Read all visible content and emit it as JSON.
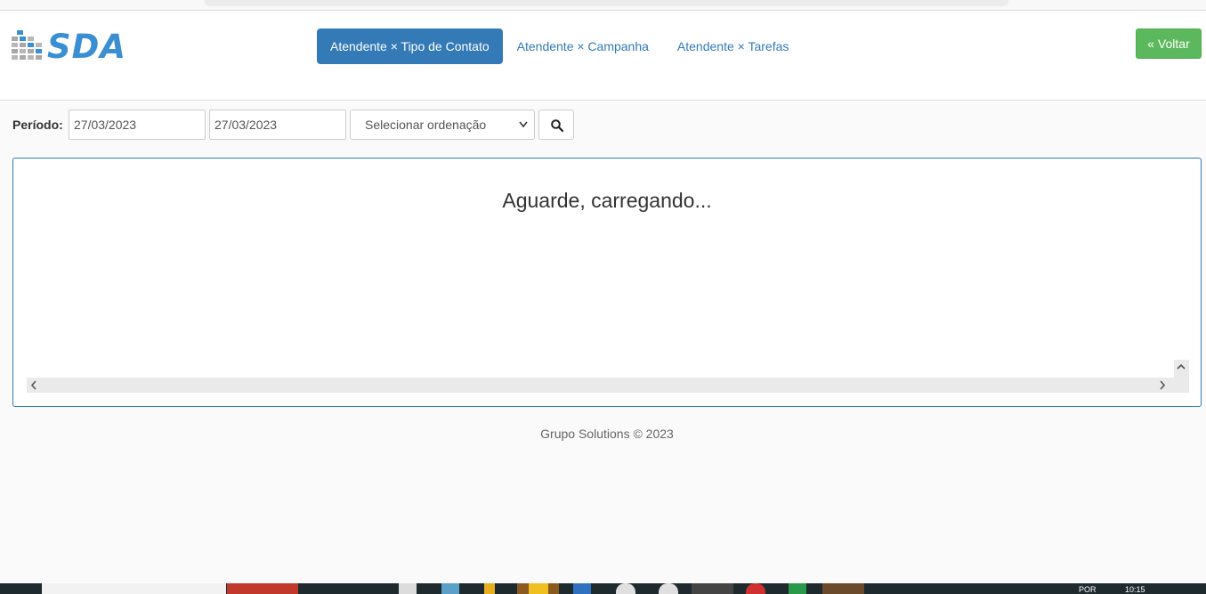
{
  "brand": {
    "logo_text": "SDA",
    "accent_color": "#337ab7"
  },
  "nav": {
    "tabs": [
      {
        "label": "Atendente × Tipo de Contato",
        "active": true
      },
      {
        "label": "Atendente × Campanha",
        "active": false
      },
      {
        "label": "Atendente × Tarefas",
        "active": false
      }
    ],
    "back_label": "« Voltar",
    "back_color": "#5cb85c"
  },
  "filter": {
    "period_label": "Período:",
    "date_start": "27/03/2023",
    "date_end": "27/03/2023",
    "order_select": "Selecionar ordenação",
    "search_icon": "search-icon"
  },
  "panel": {
    "loading_text": "Aguarde, carregando..."
  },
  "footer": {
    "text": "Grupo Solutions © 2023"
  },
  "taskbar": {
    "lang": "POR",
    "time": "10:15"
  }
}
